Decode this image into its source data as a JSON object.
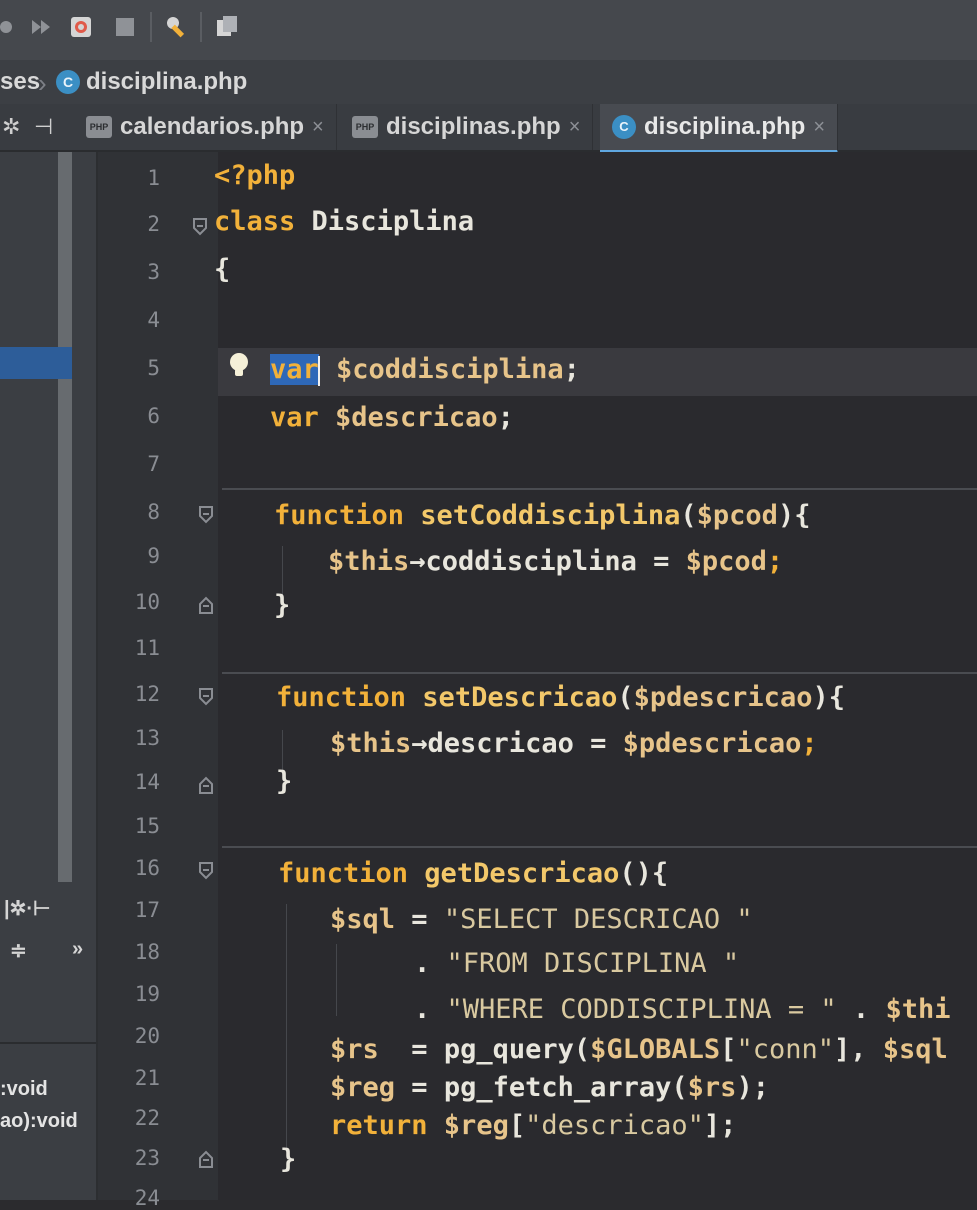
{
  "breadcrumb": {
    "partial": "ses",
    "file_icon": "C",
    "file": "disciplina.php"
  },
  "tabs": [
    {
      "label": "calendarios.php",
      "icon": "php-file-icon",
      "close": "×"
    },
    {
      "label": "disciplinas.php",
      "icon": "php-file-icon",
      "close": "×"
    },
    {
      "label": "disciplina.php",
      "icon": "class-file-icon",
      "icon_letter": "C",
      "close": "×",
      "active": true
    }
  ],
  "structure_partial": [
    ":void",
    "ao):void"
  ],
  "line_numbers": [
    "1",
    "2",
    "3",
    "4",
    "5",
    "6",
    "7",
    "8",
    "9",
    "10",
    "11",
    "12",
    "13",
    "14",
    "15",
    "16",
    "17",
    "18",
    "19",
    "20",
    "21",
    "22",
    "23",
    "24"
  ],
  "code": {
    "l1": {
      "open_tag": "<?php"
    },
    "l2": {
      "kw": "class",
      "name": " Disciplina"
    },
    "l3": {
      "brace": "{"
    },
    "l5": {
      "kw": "var",
      "var": " $coddisciplina",
      "end": ";"
    },
    "l6": {
      "kw": "var",
      "var": " $descricao",
      "end": ";"
    },
    "l8": {
      "kw": "function",
      "fn": " setCoddisciplina",
      "p1": "(",
      "param": "$pcod",
      "p2": "){"
    },
    "l9": {
      "this": "$this",
      "arrow": "→coddisciplina = ",
      "var": "$pcod",
      "end": ";"
    },
    "l10": {
      "brace": "}"
    },
    "l12": {
      "kw": "function",
      "fn": " setDescricao",
      "p1": "(",
      "param": "$pdescricao",
      "p2": "){"
    },
    "l13": {
      "this": "$this",
      "arrow": "→descricao = ",
      "var": "$pdescricao",
      "end": ";"
    },
    "l14": {
      "brace": "}"
    },
    "l16": {
      "kw": "function",
      "fn": " getDescricao",
      "p": "(){"
    },
    "l17": {
      "var": "$sql",
      "op": " = ",
      "str": "\"SELECT DESCRICAO \""
    },
    "l18": {
      "op": ". ",
      "str": "\"FROM DISCIPLINA \""
    },
    "l19": {
      "op": ". ",
      "str": "\"WHERE CODDISCIPLINA = \"",
      "op2": " . ",
      "var": "$thi"
    },
    "l20": {
      "var": "$rs",
      "op": "  = ",
      "fn": "pg_query",
      "p1": "(",
      "var2": "$GLOBALS",
      "b1": "[",
      "str": "\"conn\"",
      "b2": "], ",
      "var3": "$sql"
    },
    "l21": {
      "var": "$reg",
      "op": " = ",
      "fn": "pg_fetch_array",
      "p1": "(",
      "var2": "$rs",
      "p2": ");"
    },
    "l22": {
      "kw": "return",
      "var": " $reg",
      "b1": "[",
      "str": "\"descricao\"",
      "b2": "];"
    },
    "l23": {
      "brace": "}"
    }
  },
  "colors": {
    "keyword": "#f2b13a",
    "variable": "#e7c48a",
    "string": "#d9c9a0",
    "selection": "#2e68b8",
    "active_tab_underline": "#5fa7e0"
  }
}
